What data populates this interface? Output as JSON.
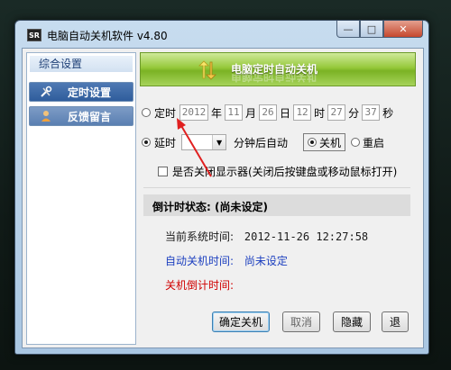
{
  "window": {
    "title": "电脑自动关机软件 v4.80",
    "icon_text": "SR"
  },
  "caption": {
    "minimize": "—",
    "maximize": "□",
    "close": "✕"
  },
  "sidebar": {
    "header": "综合设置",
    "items": [
      {
        "label": "定时设置",
        "icon": "tools-icon"
      },
      {
        "label": "反馈留言",
        "icon": "user-icon"
      }
    ]
  },
  "banner": {
    "title": "电脑定时自动关机",
    "icon": "arrows-icon"
  },
  "schedule": {
    "radio_label": "定时",
    "year": "2012",
    "year_unit": "年",
    "month": "11",
    "month_unit": "月",
    "day": "26",
    "day_unit": "日",
    "hour": "12",
    "hour_unit": "时",
    "minute": "27",
    "minute_unit": "分",
    "second": "37",
    "second_unit": "秒"
  },
  "delay": {
    "radio_label": "延时",
    "value": "",
    "suffix": "分钟后自动",
    "action_shutdown": "关机",
    "action_restart": "重启"
  },
  "monitor_option": {
    "label": "是否关闭显示器(关闭后按键盘或移动鼠标打开)"
  },
  "status": {
    "title": "倒计时状态: (尚未设定)",
    "current_time_label": "当前系统时间:",
    "current_time_value": "2012-11-26 12:27:58",
    "auto_shutdown_label": "自动关机时间:",
    "auto_shutdown_value": "尚未设定",
    "countdown_label": "关机倒计时间:"
  },
  "buttons": {
    "confirm": "确定关机",
    "cancel": "取消",
    "third": "隐藏",
    "fourth": "退"
  },
  "colors": {
    "banner_green": "#95c83a",
    "sidebar_active": "#2f5d9c",
    "status_blue": "#1c3fbf",
    "status_red": "#d00000",
    "annotation_arrow": "#e02020"
  }
}
